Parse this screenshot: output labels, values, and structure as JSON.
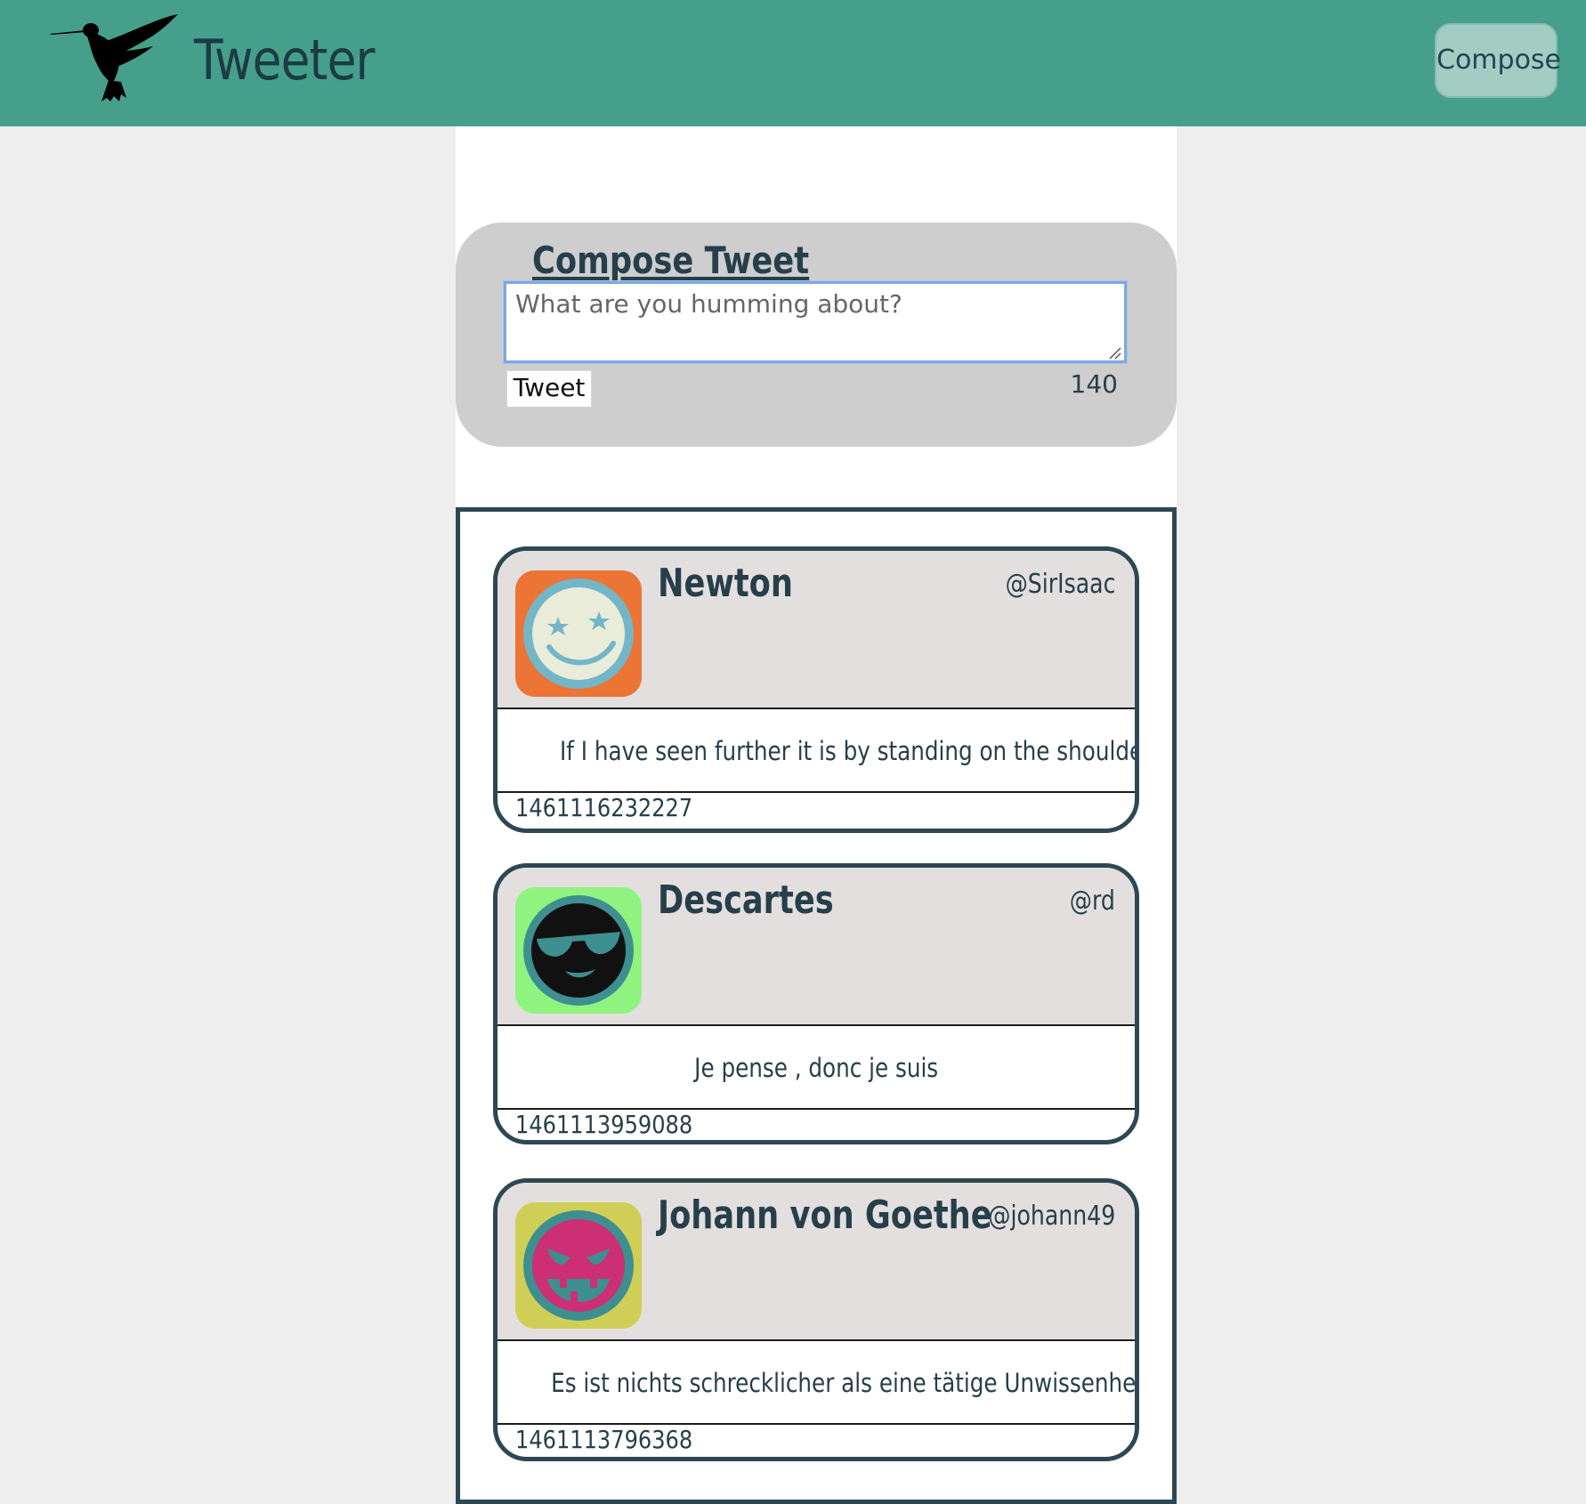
{
  "nav": {
    "brand": "Tweeter",
    "compose_label": "Compose",
    "logo_icon": "hummingbird-icon",
    "background": "#469f8b"
  },
  "compose": {
    "title": "Compose Tweet",
    "placeholder": "What are you humming about?",
    "tweet_button_label": "Tweet",
    "counter": "140"
  },
  "tweets": [
    {
      "name": "Newton",
      "handle": "@SirIsaac",
      "text": "If I have seen further it is by standing on the shoulders of giants",
      "timestamp": "1461116232227",
      "avatar_icon": "starry-eyed-smiley-icon",
      "avatar_bg": "#ec7434"
    },
    {
      "name": "Descartes",
      "handle": "@rd",
      "text": "Je pense , donc je suis",
      "timestamp": "1461113959088",
      "avatar_icon": "sunglasses-smiley-icon",
      "avatar_bg": "#8ff47f"
    },
    {
      "name": "Johann von Goethe",
      "handle": "@johann49",
      "text": "Es ist nichts schrecklicher als eine tätige Unwissenheit.",
      "timestamp": "1461113796368",
      "avatar_icon": "devilish-smiley-icon",
      "avatar_bg": "#cfcf58"
    }
  ]
}
